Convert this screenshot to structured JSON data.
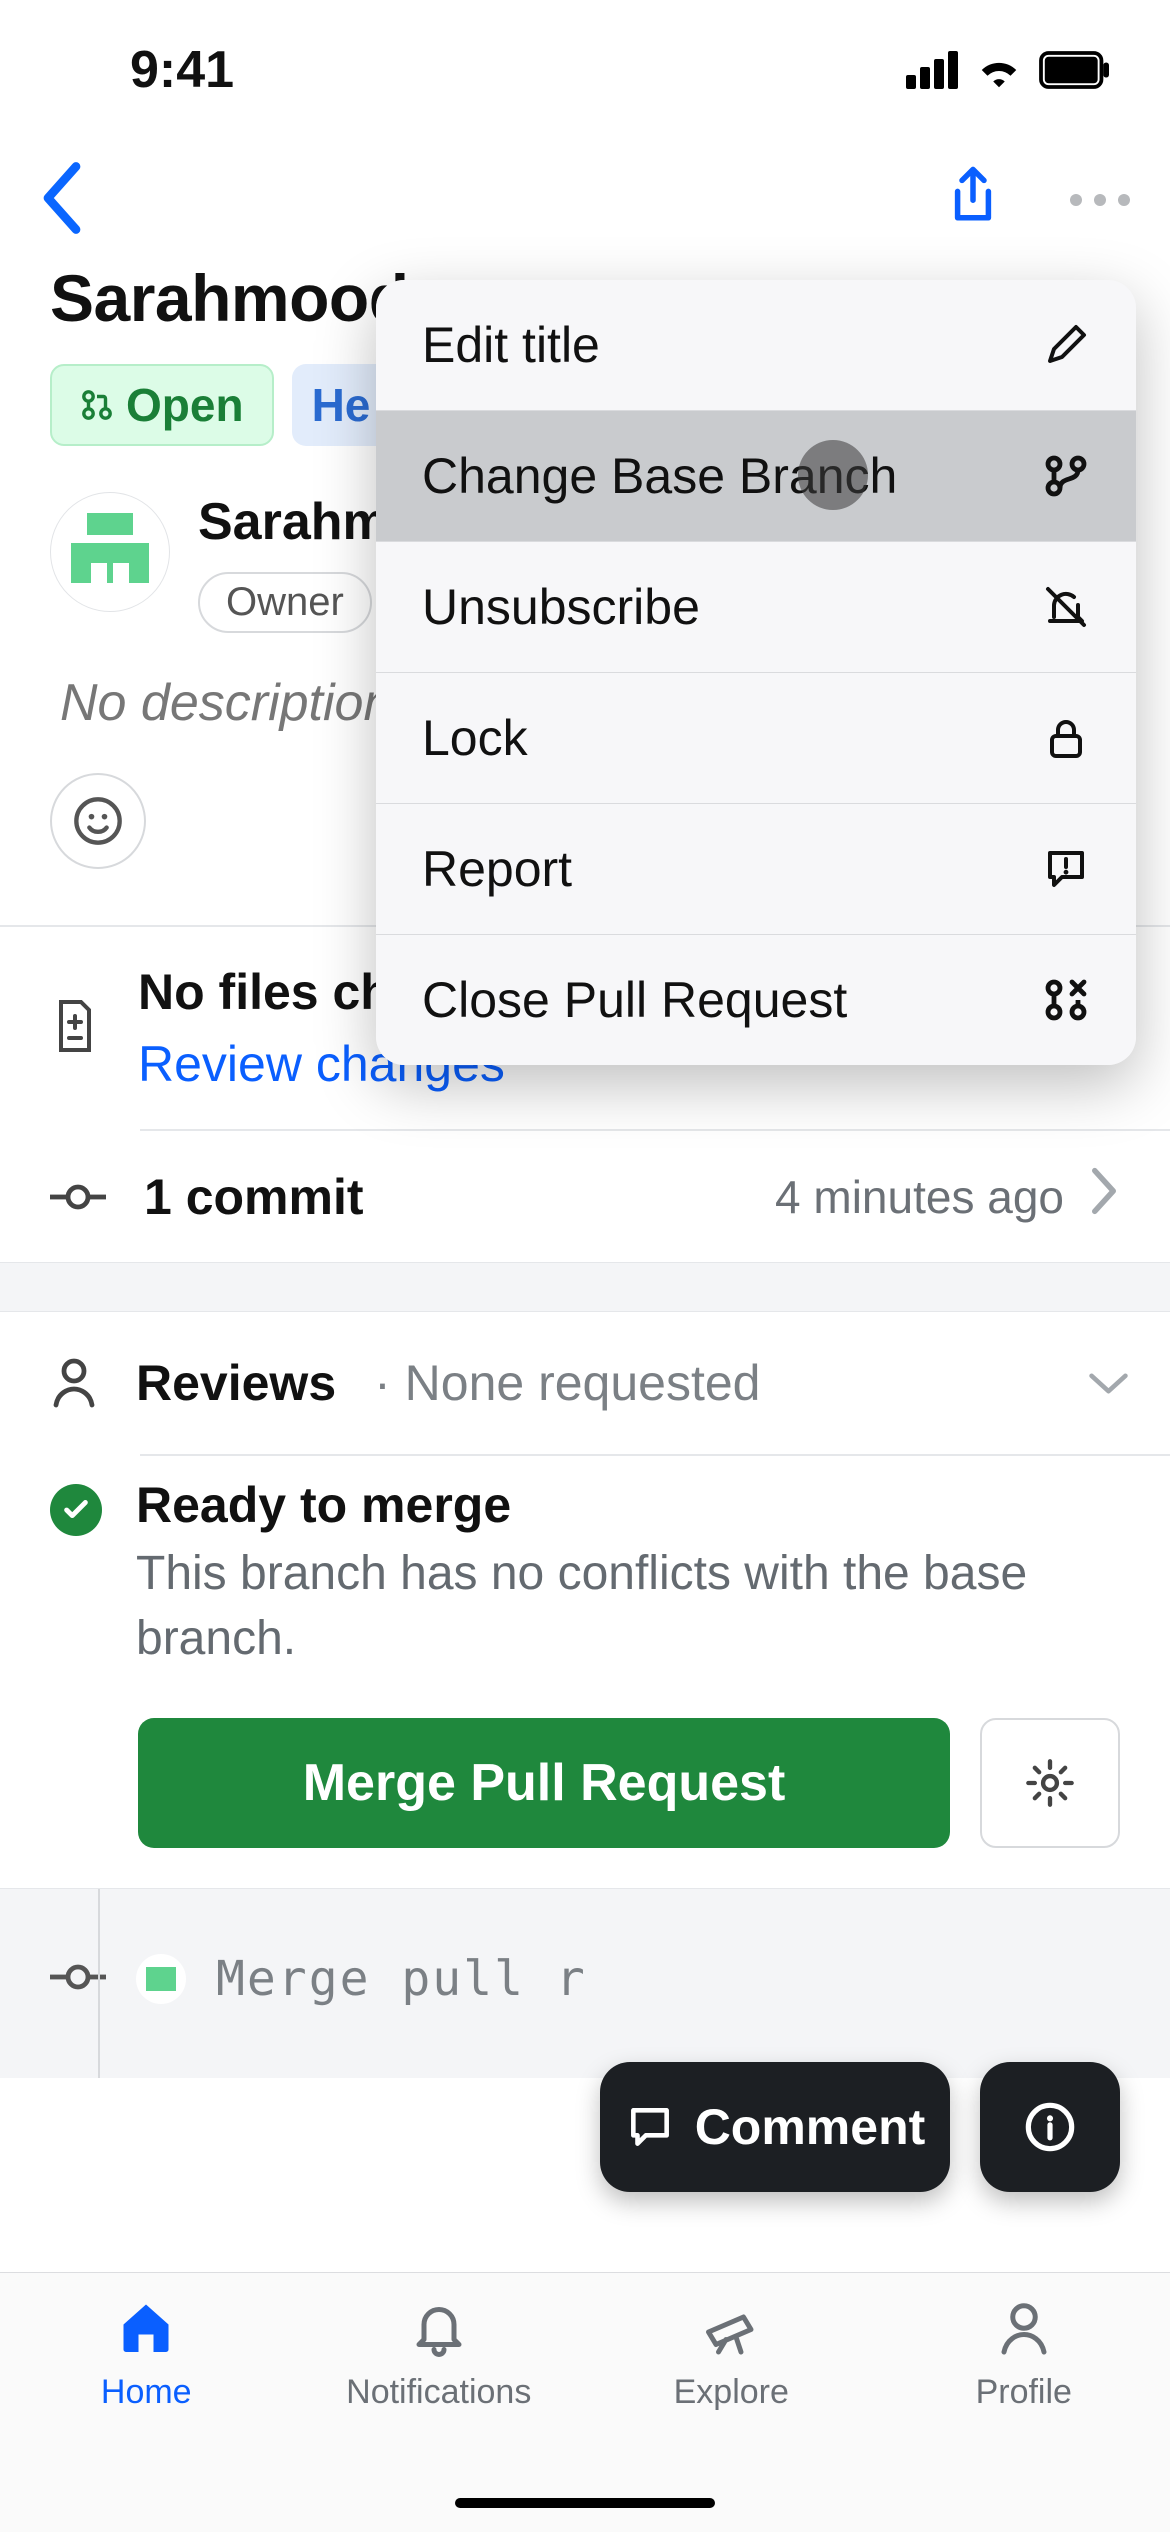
{
  "status": {
    "time": "9:41"
  },
  "title": "Sarahmood",
  "badges": {
    "open": "Open",
    "branch": "He"
  },
  "owner": {
    "name": "Sarahm",
    "role": "Owner"
  },
  "description_placeholder": "No description",
  "files": {
    "heading": "No files changed",
    "review": "Review changes"
  },
  "commits": {
    "count_label": "1 commit",
    "when": "4 minutes ago"
  },
  "reviews": {
    "label": "Reviews",
    "status": "· None requested"
  },
  "merge": {
    "ready": "Ready to merge",
    "detail": "This branch has no conflicts with the base branch.",
    "button": "Merge Pull Request"
  },
  "timeline": {
    "msg": "Merge pull r"
  },
  "floaters": {
    "comment": "Comment"
  },
  "tabs": {
    "home": "Home",
    "notifications": "Notifications",
    "explore": "Explore",
    "profile": "Profile"
  },
  "menu": {
    "edit_title": "Edit title",
    "change_base": "Change Base Branch",
    "unsubscribe": "Unsubscribe",
    "lock": "Lock",
    "report": "Report",
    "close_pr": "Close Pull Request"
  }
}
